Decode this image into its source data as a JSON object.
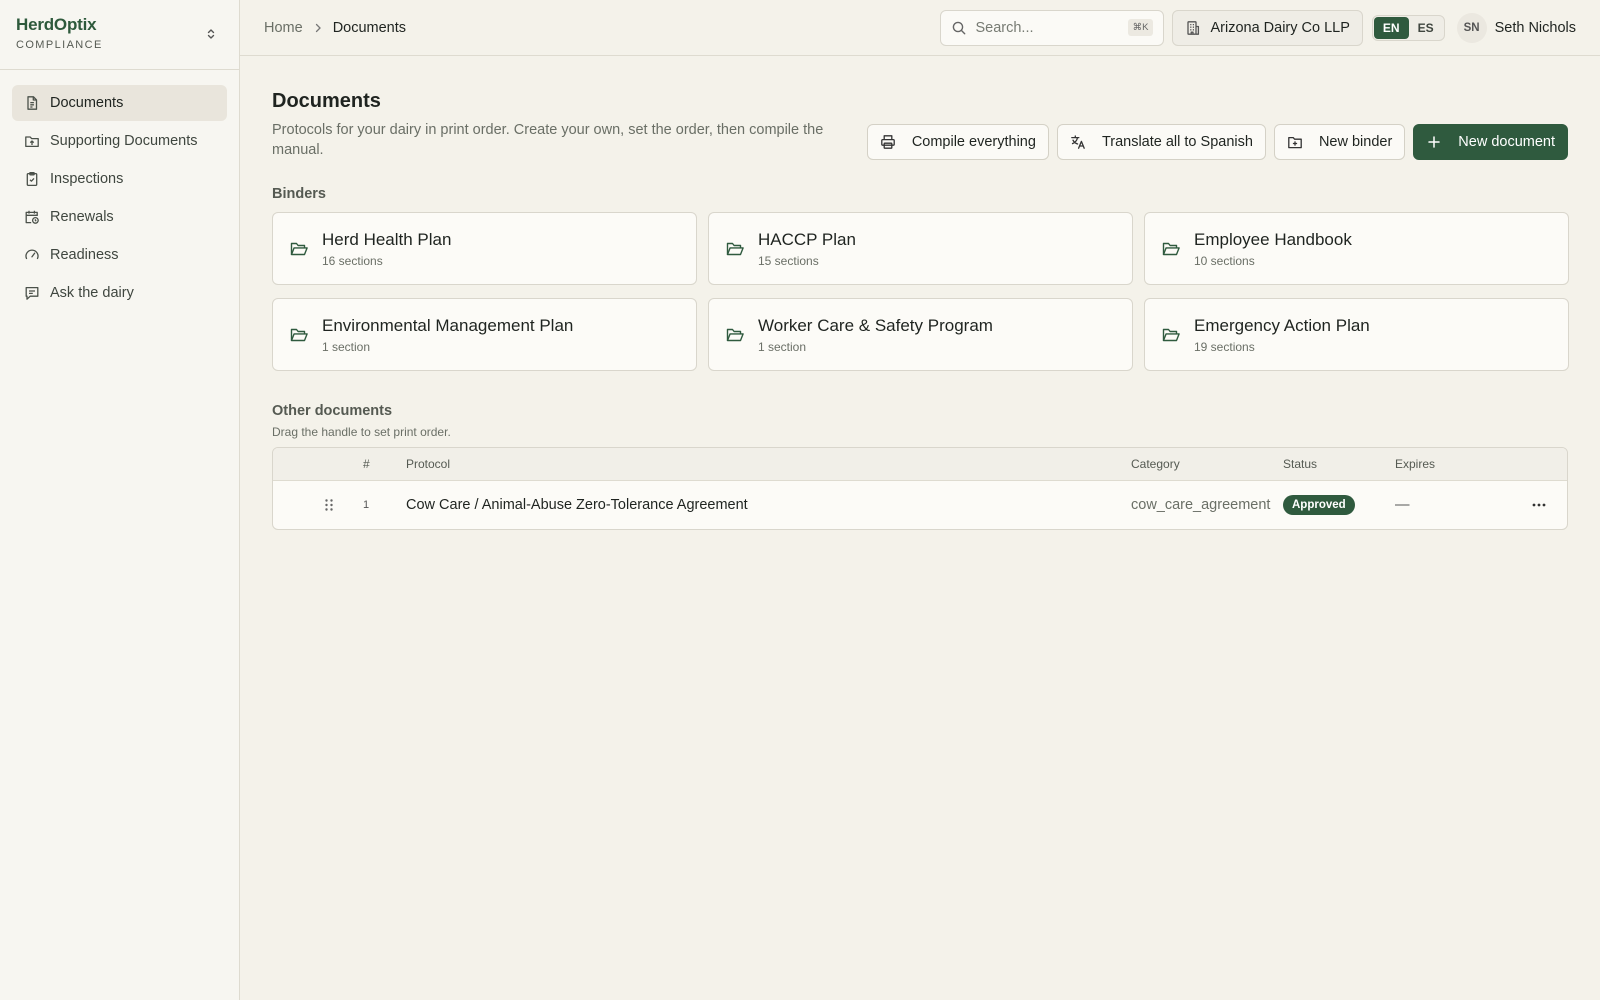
{
  "brand": {
    "name": "HerdOptix",
    "subtitle": "COMPLIANCE"
  },
  "sidebar": {
    "items": [
      {
        "label": "Documents",
        "icon": "document-icon",
        "active": true
      },
      {
        "label": "Supporting Documents",
        "icon": "folder-upload-icon"
      },
      {
        "label": "Inspections",
        "icon": "clipboard-check-icon"
      },
      {
        "label": "Renewals",
        "icon": "calendar-clock-icon"
      },
      {
        "label": "Readiness",
        "icon": "gauge-icon"
      },
      {
        "label": "Ask the dairy",
        "icon": "chat-icon"
      }
    ]
  },
  "header": {
    "breadcrumb": {
      "home": "Home",
      "current": "Documents"
    },
    "search": {
      "placeholder": "Search...",
      "shortcut": "⌘K"
    },
    "org": "Arizona Dairy Co LLP",
    "lang": {
      "en": "EN",
      "es": "ES",
      "selected": "EN"
    },
    "user": {
      "initials": "SN",
      "name": "Seth Nichols"
    }
  },
  "page": {
    "title": "Documents",
    "description": "Protocols for your dairy in print order. Create your own, set the order, then compile the manual.",
    "actions": {
      "compile": "Compile everything",
      "translate": "Translate all to Spanish",
      "new_binder": "New binder",
      "new_document": "New document"
    }
  },
  "binders": {
    "label": "Binders",
    "items": [
      {
        "title": "Herd Health Plan",
        "count": "16 sections"
      },
      {
        "title": "HACCP Plan",
        "count": "15 sections"
      },
      {
        "title": "Employee Handbook",
        "count": "10 sections"
      },
      {
        "title": "Environmental Management Plan",
        "count": "1 section"
      },
      {
        "title": "Worker Care & Safety Program",
        "count": "1 section"
      },
      {
        "title": "Emergency Action Plan",
        "count": "19 sections"
      }
    ]
  },
  "other": {
    "label": "Other documents",
    "hint": "Drag the handle to set print order.",
    "columns": {
      "num": "#",
      "protocol": "Protocol",
      "category": "Category",
      "status": "Status",
      "expires": "Expires"
    },
    "rows": [
      {
        "num": "1",
        "protocol": "Cow Care / Animal-Abuse Zero-Tolerance Agreement",
        "category": "cow_care_agreement",
        "status": "Approved",
        "expires": "—"
      }
    ]
  },
  "colors": {
    "accent": "#2f5a3e",
    "background": "#f4f2ea",
    "sidebar": "#f7f6f1"
  }
}
